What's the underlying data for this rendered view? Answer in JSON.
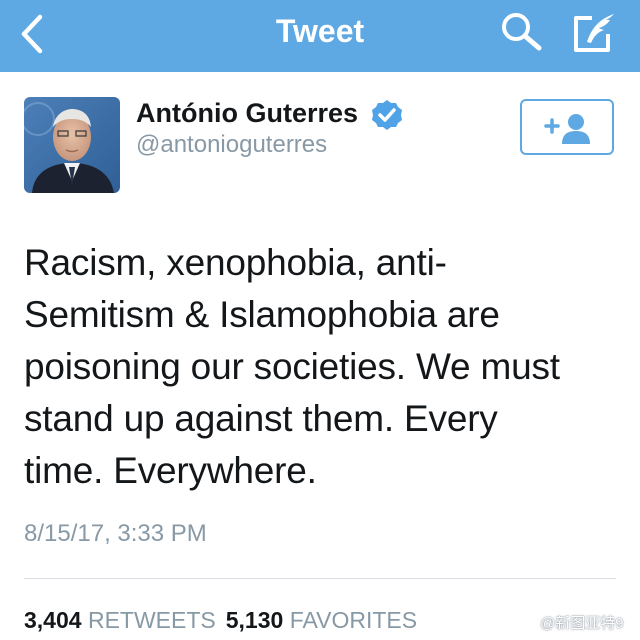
{
  "navbar": {
    "title": "Tweet",
    "background_color": "#5ea9e3",
    "back_icon": "chevron-left-icon",
    "search_icon": "search-icon",
    "compose_icon": "compose-icon"
  },
  "tweet": {
    "author_name": "António Guterres",
    "author_handle": "@antonioguterres",
    "verified_icon": "verified-badge-icon",
    "follow_icon": "follow-user-icon",
    "text_lines": [
      "Racism, xenophobia, anti-",
      "Semitism & Islamophobia are",
      "poisoning our societies. We must",
      "stand up against them. Every",
      "time. Everywhere."
    ],
    "timestamp": "8/15/17, 3:33 PM",
    "retweets_count": "3,404",
    "retweets_label": "RETWEETS",
    "favorites_count": "5,130",
    "favorites_label": "FAVORITES"
  },
  "watermark": {
    "text": "@新图亚特9"
  },
  "colors": {
    "accent": "#5ea9e3",
    "verified": "#4fa3e6",
    "muted_text": "#8899a6",
    "primary_text": "#14171a"
  }
}
